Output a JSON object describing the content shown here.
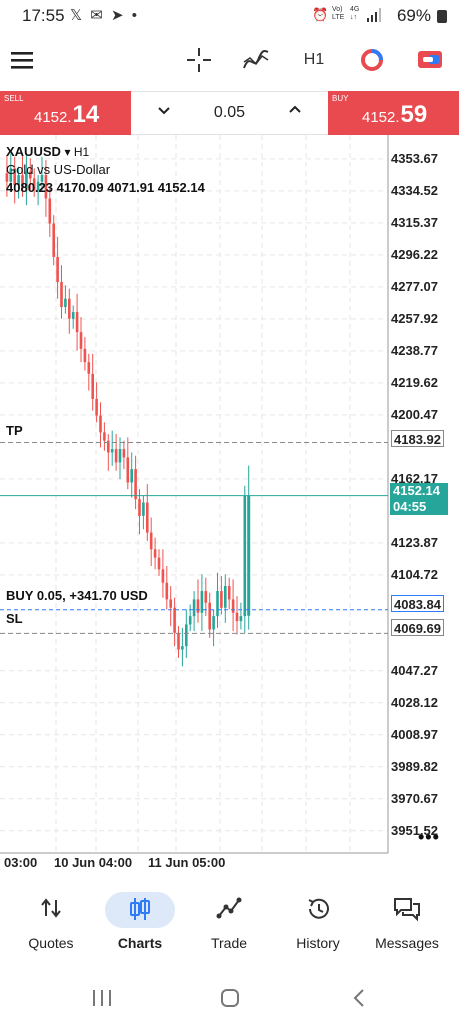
{
  "status_bar": {
    "time": "17:55",
    "right_text": "69%",
    "icons": [
      "x-icon",
      "gmail-icon",
      "telegram-icon",
      "dot-icon",
      "alarm-icon",
      "volte-icon",
      "4g-icon",
      "signal-icon",
      "battery-icon"
    ]
  },
  "toolbar": {
    "timeframe": "H1",
    "icons": [
      "menu-icon",
      "crosshair-icon",
      "indicators-icon",
      "timeframe",
      "color-scheme-icon",
      "one-click-trading-icon"
    ]
  },
  "trade": {
    "sell_label": "SELL",
    "sell_price_small": "4152.",
    "sell_price_big": "14",
    "buy_label": "BUY",
    "buy_price_small": "4152.",
    "buy_price_big": "59",
    "lot": "0.05"
  },
  "chart": {
    "symbol": "XAUUSD",
    "timeframe_marker": "▾ H1",
    "description": "Gold vs US-Dollar",
    "ohlc": "4080.23 4170.09 4071.91 4152.14",
    "tp_label": "TP",
    "sl_label": "SL",
    "position_label": "BUY 0.05,  +341.70 USD",
    "price_axis": [
      "4353.67",
      "4334.52",
      "4315.37",
      "4296.22",
      "4277.07",
      "4257.92",
      "4238.77",
      "4219.62",
      "4200.47",
      "4162.17",
      "4123.87",
      "4104.72",
      "4047.27",
      "4028.12",
      "4008.97",
      "3989.82",
      "3970.67",
      "3951.52"
    ],
    "tp_price": "4183.92",
    "current_price": "4152.14",
    "countdown": "04:55",
    "position_price": "4083.84",
    "sl_price": "4069.69",
    "time_axis": [
      "03:00",
      "10 Jun 04:00",
      "11 Jun 05:00"
    ],
    "colors": {
      "bull": "#26a69a",
      "bear": "#ef5350",
      "current_line": "#26a69a",
      "position_line": "#2f7cf6",
      "tp_sl_line": "#888888"
    }
  },
  "chart_data": {
    "type": "candlestick",
    "symbol": "XAUUSD",
    "timeframe": "H1",
    "ylim": [
      3940,
      4362
    ],
    "last": {
      "open": 4080.23,
      "high": 4170.09,
      "low": 4071.91,
      "close": 4152.14
    },
    "levels": {
      "tp": 4183.92,
      "current": 4152.14,
      "position": 4083.84,
      "sl": 4069.69
    }
  },
  "bottom_nav": {
    "items": [
      {
        "label": "Quotes",
        "icon": "quotes-icon"
      },
      {
        "label": "Charts",
        "icon": "charts-icon"
      },
      {
        "label": "Trade",
        "icon": "trade-icon"
      },
      {
        "label": "History",
        "icon": "history-icon"
      },
      {
        "label": "Messages",
        "icon": "messages-icon"
      }
    ]
  }
}
